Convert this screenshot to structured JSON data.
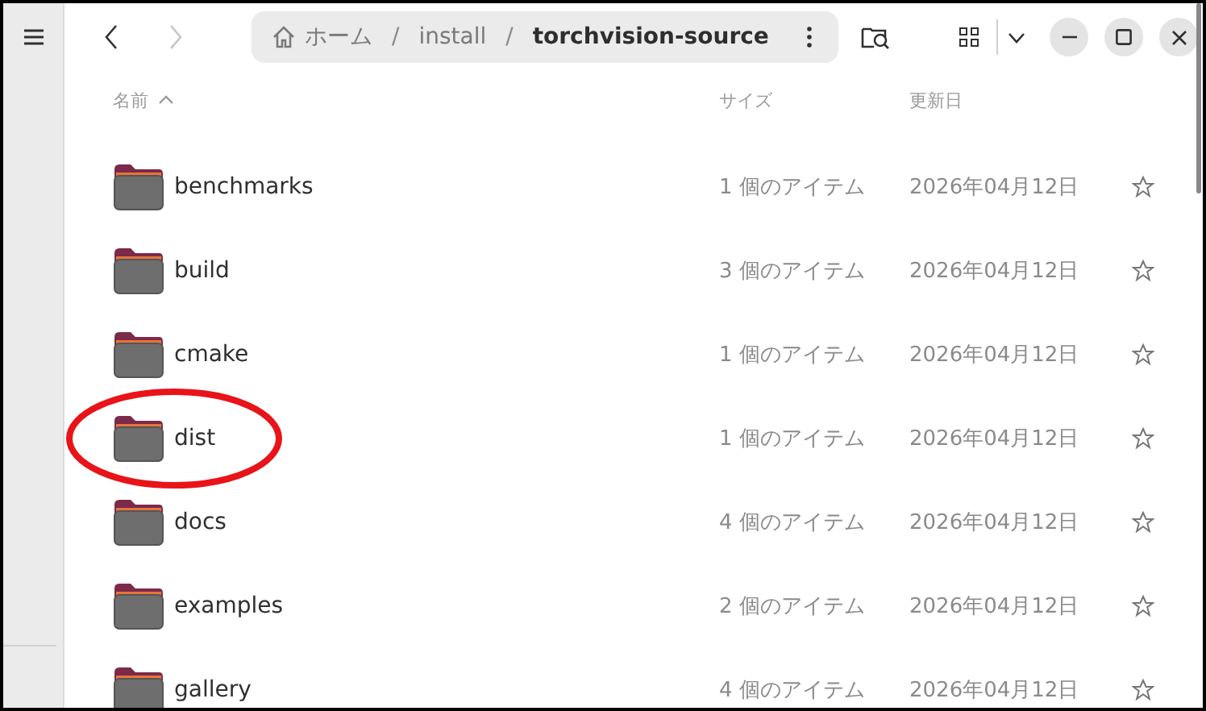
{
  "path": [
    {
      "label": "ホーム",
      "kind": "home",
      "current": false
    },
    {
      "label": "install",
      "kind": "folder",
      "current": false,
      "separator": "/"
    },
    {
      "label": "torchvision-source",
      "kind": "folder",
      "current": true,
      "separator": "/"
    }
  ],
  "nav": {
    "back_disabled": false,
    "forward_disabled": true
  },
  "columns": [
    {
      "label": "名前",
      "sorted": true
    },
    {
      "label": "サイズ",
      "sorted": false
    },
    {
      "label": "更新日",
      "sorted": false
    }
  ],
  "rows": [
    {
      "name": "benchmarks",
      "size": "1 個のアイテム",
      "modified": "2026年04月12日",
      "starred": false,
      "circled": false
    },
    {
      "name": "build",
      "size": "3 個のアイテム",
      "modified": "2026年04月12日",
      "starred": false,
      "circled": false
    },
    {
      "name": "cmake",
      "size": "1 個のアイテム",
      "modified": "2026年04月12日",
      "starred": false,
      "circled": false
    },
    {
      "name": "dist",
      "size": "1 個のアイテム",
      "modified": "2026年04月12日",
      "starred": false,
      "circled": true
    },
    {
      "name": "docs",
      "size": "4 個のアイテム",
      "modified": "2026年04月12日",
      "starred": false,
      "circled": false
    },
    {
      "name": "examples",
      "size": "2 個のアイテム",
      "modified": "2026年04月12日",
      "starred": false,
      "circled": false
    },
    {
      "name": "gallery",
      "size": "4 個のアイテム",
      "modified": "2026年04月12日",
      "starred": false,
      "circled": false
    }
  ]
}
